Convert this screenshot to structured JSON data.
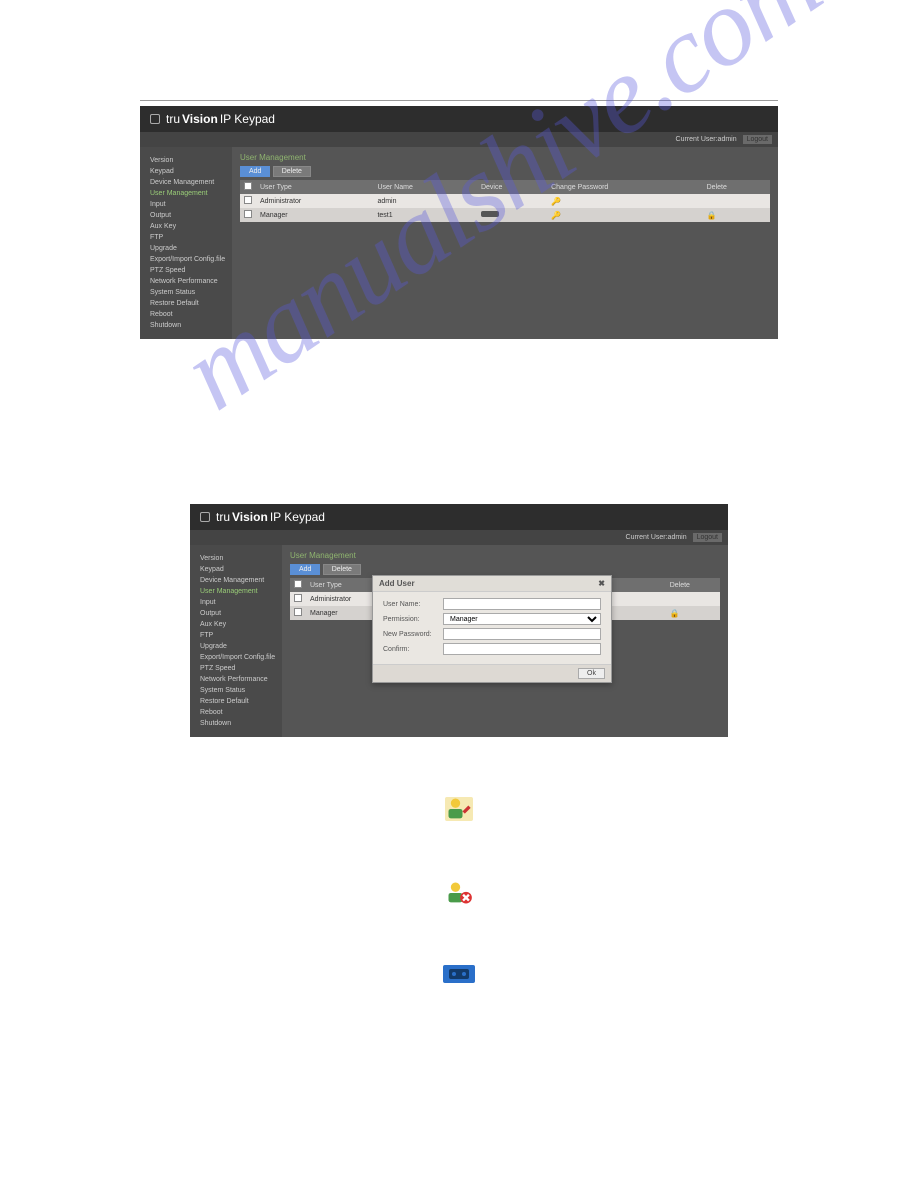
{
  "brand": {
    "name1": "tru",
    "name2": "Vision",
    "product": " IP Keypad"
  },
  "userbar": {
    "current": "Current User:admin",
    "logout": "Logout"
  },
  "sidebar": {
    "items": [
      "Version",
      "Keypad",
      "Device Management",
      "User Management",
      "Input",
      "Output",
      "Aux Key",
      "FTP",
      "Upgrade",
      "Export/Import Config.file",
      "PTZ Speed",
      "Network Performance",
      "System Status",
      "Restore Default",
      "Reboot",
      "Shutdown"
    ],
    "activeIndex": 3
  },
  "section": {
    "title": "User Management",
    "buttons": {
      "add": "Add",
      "delete": "Delete"
    },
    "columns": [
      "",
      "User Type",
      "User Name",
      "Device",
      "Change Password",
      "Delete"
    ],
    "rows": [
      {
        "type": "Administrator",
        "name": "admin",
        "device": "",
        "pwd": true,
        "del": false
      },
      {
        "type": "Manager",
        "name": "test1",
        "device": "dev",
        "pwd": true,
        "del": true
      }
    ]
  },
  "dialog": {
    "title": "Add User",
    "labels": {
      "username": "User Name:",
      "permission": "Permission:",
      "newpw": "New Password:",
      "confirm": "Confirm:"
    },
    "permissionValue": "Manager",
    "ok": "Ok"
  },
  "watermark": "manualshive.com"
}
